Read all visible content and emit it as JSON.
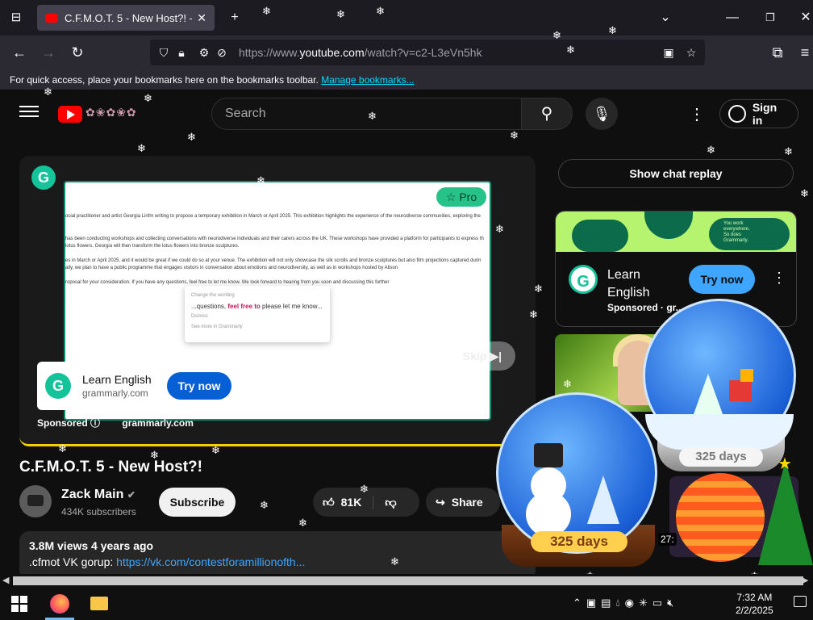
{
  "browser": {
    "tab_title": "C.F.M.O.T. 5 - New Host?! - You",
    "tab_close": "✕",
    "new_tab": "+",
    "url_prefix": "https://www.",
    "url_domain": "youtube.com",
    "url_path": "/watch?v=c2-L3eVn5hk",
    "bookmarks_text": "For quick access, place your bookmarks here on the bookmarks toolbar.",
    "bookmarks_link": "Manage bookmarks..."
  },
  "youtube": {
    "search_placeholder": "Search",
    "sign_in": "Sign in",
    "video_title": "C.F.M.O.T. 5 - New Host?!",
    "channel_name": "Zack Main",
    "subscribers": "434K subscribers",
    "subscribe": "Subscribe",
    "likes": "81K",
    "share": "Share",
    "views_date": "3.8M views  4 years ago",
    "description_prefix": ".cfmot VK gorup: ",
    "description_link": "https://vk.com/contestforamillionofth...",
    "chat_replay": "Show chat replay"
  },
  "player_ad": {
    "pro_badge": "☆ Pro",
    "doc_lines": [
      "ocial practitioner and artist Georgia Linfm writing to propose a temporary exhibition in March or April 2025. This exhibition highlights the experience of the neurodiverse communities, exploring the",
      "has been conducting workshops and collecting conversations with neurodiverse individuals and their carers across the UK. These workshops have provided a platform for participants to express th",
      "lotus flowers.  Georgia will then transform the lotus flowers into bronze sculptures.",
      "es in March or April 2025, and it would be great if we could do so at your venue. The exhibition will not only showcase the silk scrolls and bronze sculptures but also film projections captured durin",
      "ally, we plan to have a public programme that engages visitors in conversation about emotions and neurodiversity, as well as in workshops hosted by Alison",
      "roposal for your consideration. If you have any questions, feel free to let me know. We look forward to hearing from you soon and discussing this further"
    ],
    "popup_header": "Change the wording",
    "popup_text_a": "...questions, ",
    "popup_text_hl": "feel free to",
    "popup_text_b": " please let me know...",
    "popup_dismiss": "Dismiss",
    "popup_more": "See more in Grammarly",
    "card_title": "Learn English",
    "card_domain": "grammarly.com",
    "card_button": "Try now",
    "skip": "Skip ▶|",
    "sponsored": "Sponsored",
    "sponsored_domain": "grammarly.com"
  },
  "side_ad": {
    "banner_text": "You work everywhere. So does Grammarly.",
    "title": "Learn English",
    "sponsored": "Sponsored · gr...",
    "button": "Try now"
  },
  "globes": {
    "left_label": "325 days",
    "right_label": "325 days"
  },
  "thumb_duration": "27:",
  "taskbar": {
    "time": "7:32 AM",
    "date": "2/2/2025"
  }
}
